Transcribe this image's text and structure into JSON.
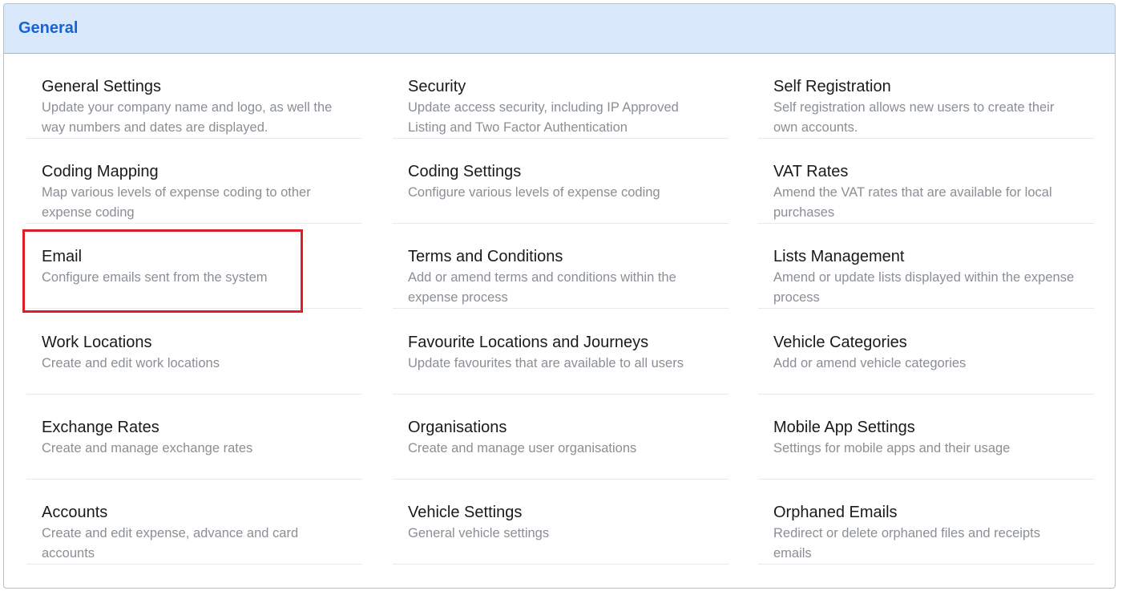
{
  "panel": {
    "title": "General"
  },
  "items": [
    {
      "title": "General Settings",
      "desc": "Update your company name and logo, as well the way numbers and dates are displayed."
    },
    {
      "title": "Security",
      "desc": "Update access security, including IP Approved Listing and Two Factor Authentication"
    },
    {
      "title": "Self Registration",
      "desc": "Self registration allows new users to create their own accounts."
    },
    {
      "title": "Coding Mapping",
      "desc": "Map various levels of expense coding to other expense coding"
    },
    {
      "title": "Coding Settings",
      "desc": "Configure various levels of expense coding"
    },
    {
      "title": "VAT Rates",
      "desc": "Amend the VAT rates that are available for local purchases"
    },
    {
      "title": "Email",
      "desc": "Configure emails sent from the system"
    },
    {
      "title": "Terms and Conditions",
      "desc": "Add or amend terms and conditions within the expense process"
    },
    {
      "title": "Lists Management",
      "desc": "Amend or update lists displayed within the expense process"
    },
    {
      "title": "Work Locations",
      "desc": "Create and edit work locations"
    },
    {
      "title": "Favourite Locations and Journeys",
      "desc": "Update favourites that are available to all users"
    },
    {
      "title": "Vehicle Categories",
      "desc": "Add or amend vehicle categories"
    },
    {
      "title": "Exchange Rates",
      "desc": "Create and manage exchange rates"
    },
    {
      "title": "Organisations",
      "desc": "Create and manage user organisations"
    },
    {
      "title": "Mobile App Settings",
      "desc": "Settings for mobile apps and their usage"
    },
    {
      "title": "Accounts",
      "desc": "Create and edit expense, advance and card accounts"
    },
    {
      "title": "Vehicle Settings",
      "desc": "General vehicle settings"
    },
    {
      "title": "Orphaned Emails",
      "desc": "Redirect or delete orphaned files and receipts emails"
    }
  ],
  "highlight": {
    "target": "Email",
    "color": "#dc1f26"
  }
}
